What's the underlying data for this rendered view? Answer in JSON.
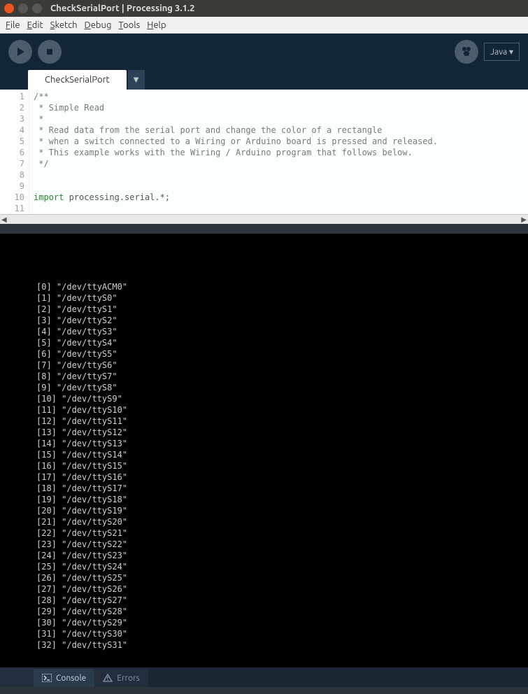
{
  "window": {
    "title": "CheckSerialPort | Processing 3.1.2"
  },
  "menu": {
    "file": "File",
    "edit": "Edit",
    "sketch": "Sketch",
    "debug": "Debug",
    "tools": "Tools",
    "help": "Help"
  },
  "toolbar": {
    "mode": "Java ▾"
  },
  "tabs": {
    "current": "CheckSerialPort",
    "dd": "▼"
  },
  "code": {
    "lines": [
      "/**",
      " * Simple Read",
      " * ",
      " * Read data from the serial port and change the color of a rectangle",
      " * when a switch connected to a Wiring or Arduino board is pressed and released.",
      " * This example works with the Wiring / Arduino program that follows below.",
      " */",
      "",
      "",
      "import processing.serial.*;",
      ""
    ],
    "import_kw": "import",
    "import_pkg": " processing.serial.*;"
  },
  "hscroll": {
    "left": "◀",
    "right": "▶"
  },
  "console": {
    "lines": [
      "[0] \"/dev/ttyACM0\"",
      "[1] \"/dev/ttyS0\"",
      "[2] \"/dev/ttyS1\"",
      "[3] \"/dev/ttyS2\"",
      "[4] \"/dev/ttyS3\"",
      "[5] \"/dev/ttyS4\"",
      "[6] \"/dev/ttyS5\"",
      "[7] \"/dev/ttyS6\"",
      "[8] \"/dev/ttyS7\"",
      "[9] \"/dev/ttyS8\"",
      "[10] \"/dev/ttyS9\"",
      "[11] \"/dev/ttyS10\"",
      "[12] \"/dev/ttyS11\"",
      "[13] \"/dev/ttyS12\"",
      "[14] \"/dev/ttyS13\"",
      "[15] \"/dev/ttyS14\"",
      "[16] \"/dev/ttyS15\"",
      "[17] \"/dev/ttyS16\"",
      "[18] \"/dev/ttyS17\"",
      "[19] \"/dev/ttyS18\"",
      "[20] \"/dev/ttyS19\"",
      "[21] \"/dev/ttyS20\"",
      "[22] \"/dev/ttyS21\"",
      "[23] \"/dev/ttyS22\"",
      "[24] \"/dev/ttyS23\"",
      "[25] \"/dev/ttyS24\"",
      "[26] \"/dev/ttyS25\"",
      "[27] \"/dev/ttyS26\"",
      "[28] \"/dev/ttyS27\"",
      "[29] \"/dev/ttyS28\"",
      "[30] \"/dev/ttyS29\"",
      "[31] \"/dev/ttyS30\"",
      "[32] \"/dev/ttyS31\""
    ]
  },
  "status": {
    "console": "Console",
    "errors": "Errors"
  }
}
